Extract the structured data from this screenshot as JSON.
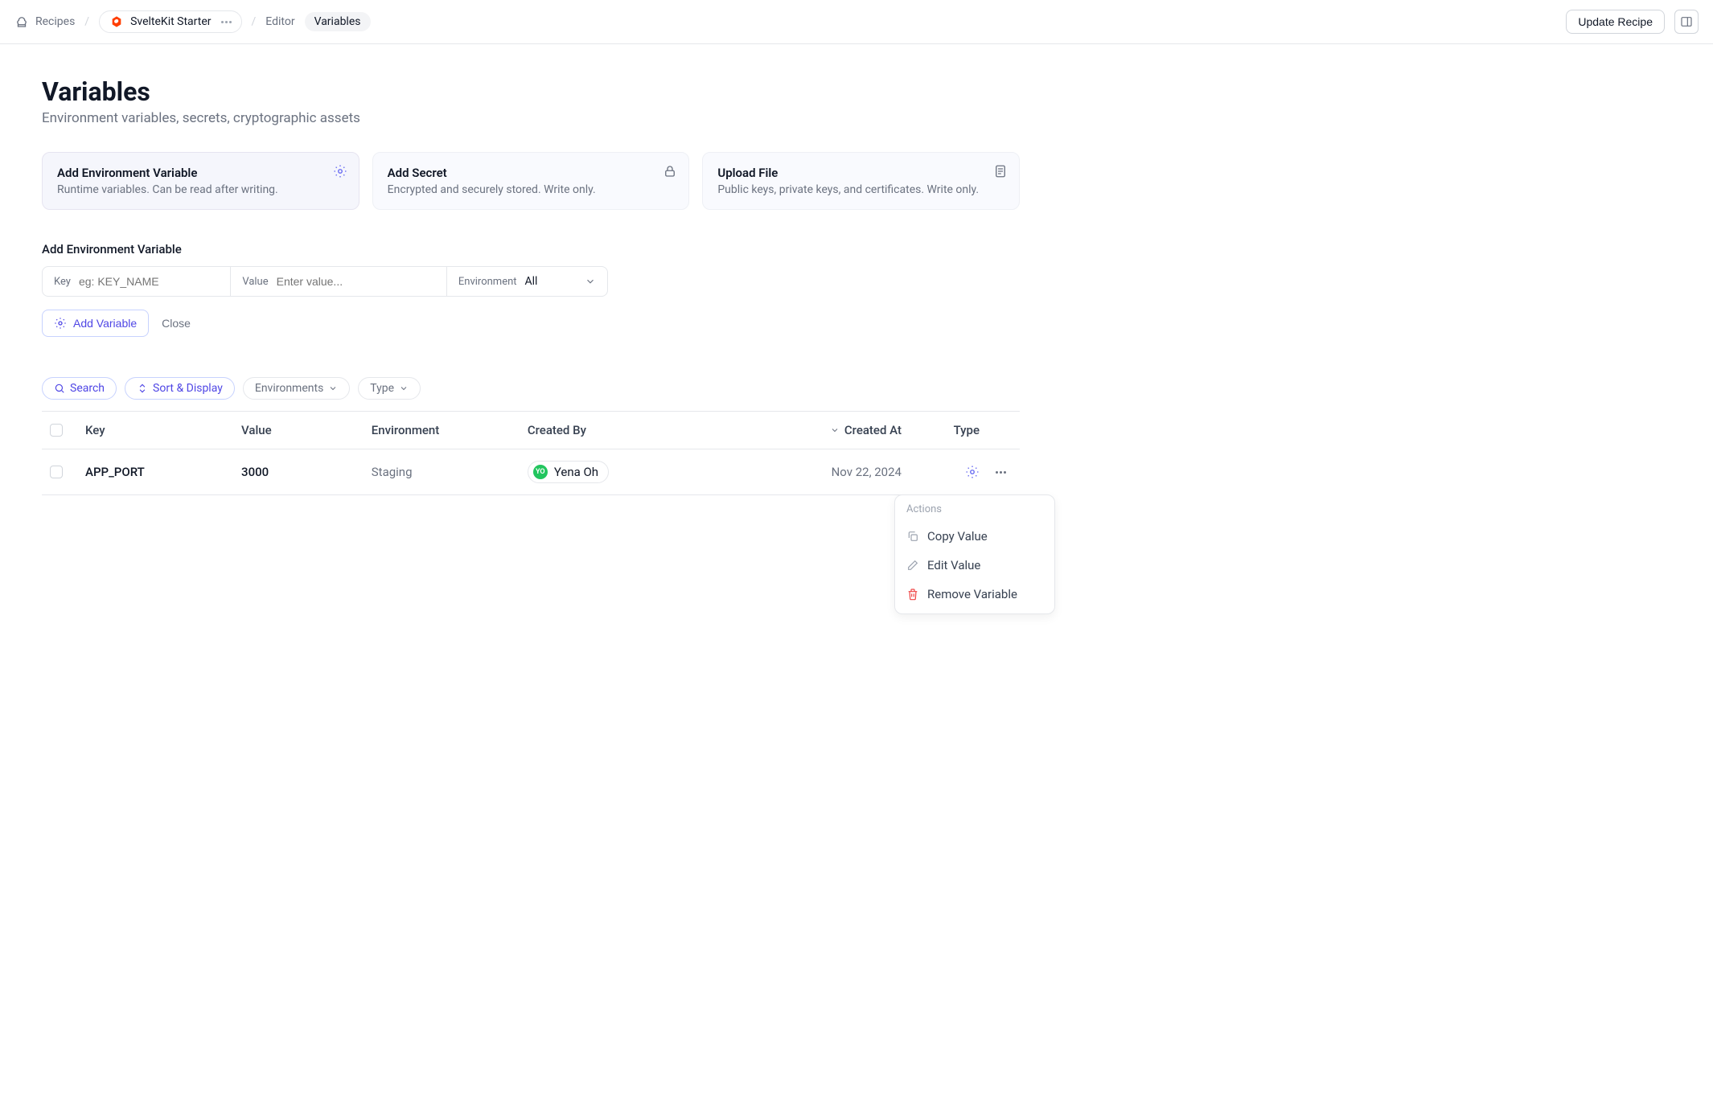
{
  "breadcrumb": {
    "root": "Recipes",
    "project": "SvelteKit Starter",
    "editor": "Editor",
    "current": "Variables"
  },
  "top_actions": {
    "update": "Update Recipe"
  },
  "page": {
    "title": "Variables",
    "subtitle": "Environment variables, secrets, cryptographic assets"
  },
  "cards": {
    "env": {
      "title": "Add Environment Variable",
      "desc": "Runtime variables. Can be read after writing."
    },
    "secret": {
      "title": "Add Secret",
      "desc": "Encrypted and securely stored. Write only."
    },
    "upload": {
      "title": "Upload File",
      "desc": "Public keys, private keys, and certificates. Write only."
    }
  },
  "form": {
    "section_title": "Add Environment Variable",
    "key_label": "Key",
    "key_placeholder": "eg: KEY_NAME",
    "value_label": "Value",
    "value_placeholder": "Enter value...",
    "env_label": "Environment",
    "env_selected": "All",
    "add_btn": "Add Variable",
    "close_btn": "Close"
  },
  "filters": {
    "search": "Search",
    "sort": "Sort & Display",
    "environments": "Environments",
    "type": "Type"
  },
  "table": {
    "headers": {
      "key": "Key",
      "value": "Value",
      "environment": "Environment",
      "created_by": "Created By",
      "created_at": "Created At",
      "type": "Type"
    },
    "rows": [
      {
        "key": "APP_PORT",
        "value": "3000",
        "environment": "Staging",
        "created_by": {
          "initials": "YO",
          "name": "Yena Oh"
        },
        "created_at": "Nov 22, 2024"
      }
    ]
  },
  "context_menu": {
    "header": "Actions",
    "copy": "Copy Value",
    "edit": "Edit Value",
    "remove": "Remove Variable"
  }
}
